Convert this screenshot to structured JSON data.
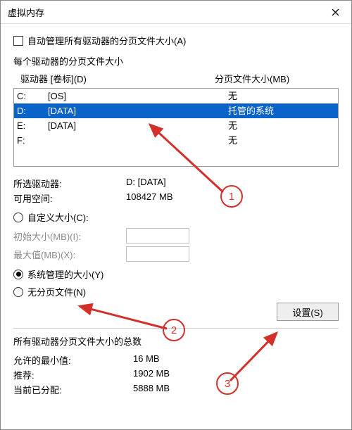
{
  "window": {
    "title": "虚拟内存"
  },
  "auto_manage": {
    "label": "自动管理所有驱动器的分页文件大小(A)",
    "checked": false
  },
  "perdrive_label": "每个驱动器的分页文件大小",
  "list_headers": {
    "drive": "驱动器 [卷标](D)",
    "paging": "分页文件大小(MB)"
  },
  "drives": [
    {
      "letter": "C:",
      "label": "[OS]",
      "paging": "无",
      "selected": false
    },
    {
      "letter": "D:",
      "label": "[DATA]",
      "paging": "托管的系统",
      "selected": true
    },
    {
      "letter": "E:",
      "label": "[DATA]",
      "paging": "无",
      "selected": false
    },
    {
      "letter": "F:",
      "label": "",
      "paging": "无",
      "selected": false
    }
  ],
  "selected_drive": {
    "label": "所选驱动器:",
    "value": "D:  [DATA]"
  },
  "free_space": {
    "label": "可用空间:",
    "value": "108427 MB"
  },
  "size_mode": {
    "custom": {
      "label": "自定义大小(C):",
      "checked": false
    },
    "initial": {
      "label": "初始大小(MB)(I):",
      "value": ""
    },
    "max": {
      "label": "最大值(MB)(X):",
      "value": ""
    },
    "system": {
      "label": "系统管理的大小(Y)",
      "checked": true
    },
    "none": {
      "label": "无分页文件(N)",
      "checked": false
    }
  },
  "set_button": "设置(S)",
  "totals_title": "所有驱动器分页文件大小的总数",
  "totals": {
    "min": {
      "label": "允许的最小值:",
      "value": "16 MB"
    },
    "recommend": {
      "label": "推荐:",
      "value": "1902 MB"
    },
    "current": {
      "label": "当前已分配:",
      "value": "5888 MB"
    }
  },
  "annotations": {
    "n1": "1",
    "n2": "2",
    "n3": "3"
  }
}
